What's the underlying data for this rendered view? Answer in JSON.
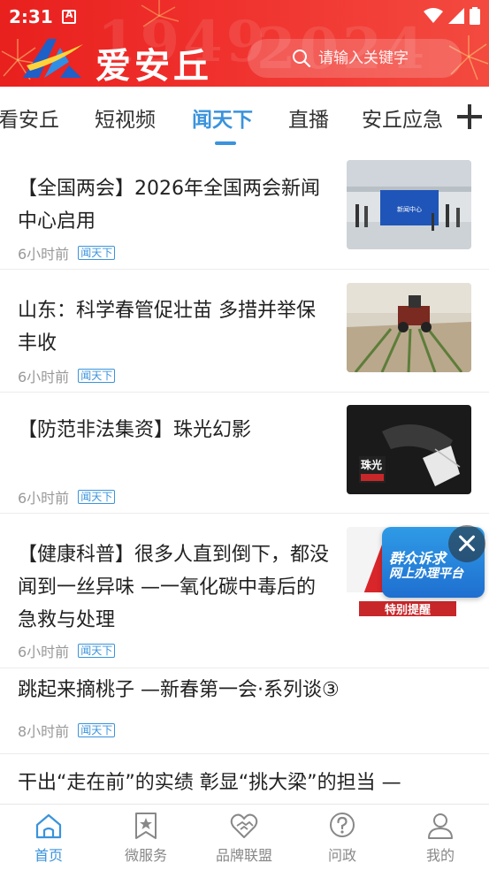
{
  "status_bar": {
    "time": "2:31"
  },
  "header": {
    "app_title": "爱安丘",
    "ghost_left": "1949",
    "ghost_right": "2024",
    "search_placeholder": "请输入关键字"
  },
  "tabs": {
    "items": [
      "看安丘",
      "短视频",
      "闻天下",
      "直播",
      "安丘应急"
    ],
    "active": "闻天下"
  },
  "news": [
    {
      "title": "【全国两会】2026年全国两会新闻中心启用",
      "time": "6小时前",
      "tag": "闻天下"
    },
    {
      "title": "山东：科学春管促壮苗  多措并举保丰收",
      "time": "6小时前",
      "tag": "闻天下"
    },
    {
      "title": "【防范非法集资】珠光幻影",
      "time": "6小时前",
      "tag": "闻天下"
    },
    {
      "title": "【健康科普】很多人直到倒下，都没闻到一丝异味  —一氧化碳中毒后的急救与处理",
      "time": "6小时前",
      "tag": "闻天下"
    },
    {
      "title": "跳起来摘桃子  —新春第一会·系列谈③",
      "time": "8小时前",
      "tag": "闻天下"
    },
    {
      "title": "干出“走在前”的实绩  彰显“挑大梁”的担当  —",
      "time": "",
      "tag": ""
    }
  ],
  "thumb_texts": {
    "press_center_sign": "新闻中心",
    "fraud_logo": "珠光",
    "warning_sign": "特别提醒"
  },
  "float_badge": {
    "line1": "群众诉求",
    "line2": "网上办理平台"
  },
  "bottom_nav": {
    "items": [
      "首页",
      "微服务",
      "品牌联盟",
      "问政",
      "我的"
    ],
    "active": "首页"
  },
  "colors": {
    "brand_red": "#e8201e",
    "accent_blue": "#3a93dc"
  }
}
